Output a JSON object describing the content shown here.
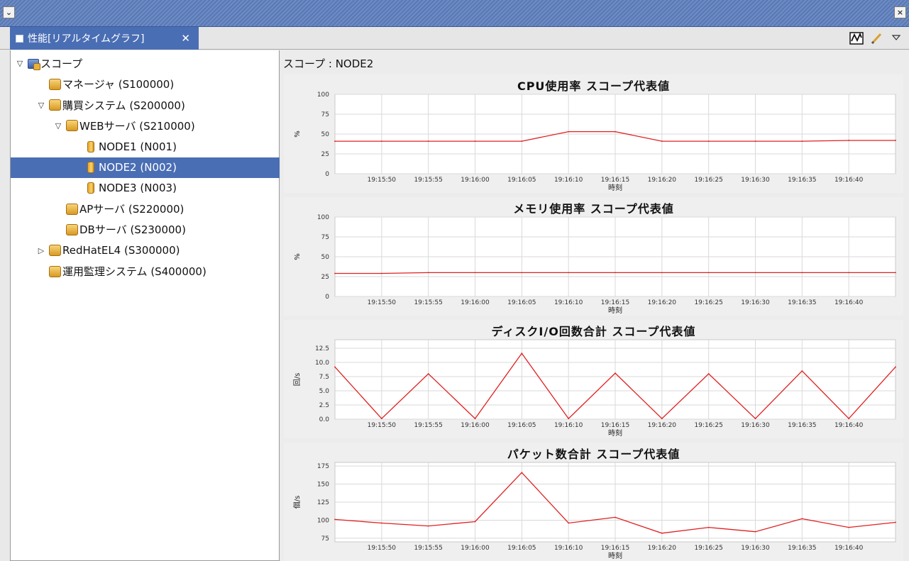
{
  "window": {
    "menu_icon": "chevron-down-icon",
    "close_icon": "close-icon"
  },
  "tab": {
    "label": "性能[リアルタイムグラフ]",
    "close_icon": "close-icon"
  },
  "toolbar": {
    "items": [
      "graph-icon",
      "pencil-icon",
      "view-menu-icon"
    ]
  },
  "tree": {
    "items": [
      {
        "label": "スコープ",
        "level": 0,
        "icon": "scope-icon",
        "twisty": "expanded"
      },
      {
        "label": "マネージャ (S100000)",
        "level": 1,
        "icon": "folder-icon",
        "twisty": "none"
      },
      {
        "label": "購買システム (S200000)",
        "level": 1,
        "icon": "folder-icon",
        "twisty": "expanded"
      },
      {
        "label": "WEBサーバ (S210000)",
        "level": 2,
        "icon": "folder-icon",
        "twisty": "expanded"
      },
      {
        "label": "NODE1 (N001)",
        "level": 3,
        "icon": "node-icon",
        "twisty": "none"
      },
      {
        "label": "NODE2 (N002)",
        "level": 3,
        "icon": "node-icon",
        "twisty": "none",
        "selected": true
      },
      {
        "label": "NODE3 (N003)",
        "level": 3,
        "icon": "node-icon",
        "twisty": "none"
      },
      {
        "label": "APサーバ (S220000)",
        "level": 2,
        "icon": "folder-icon",
        "twisty": "none"
      },
      {
        "label": "DBサーバ (S230000)",
        "level": 2,
        "icon": "folder-icon",
        "twisty": "none"
      },
      {
        "label": "RedHatEL4 (S300000)",
        "level": 1,
        "icon": "folder-icon",
        "twisty": "collapsed"
      },
      {
        "label": "運用監理システム (S400000)",
        "level": 1,
        "icon": "folder-icon",
        "twisty": "none"
      }
    ]
  },
  "scope_label": "スコープ : NODE2",
  "colors": {
    "series": "#e02020",
    "grid": "#d9d9d9",
    "selection": "#4a6eb4"
  },
  "chart_data": [
    {
      "type": "line",
      "title": "CPU使用率 スコープ代表値",
      "xlabel": "時刻",
      "ylabel": "%",
      "x": [
        "19:15:45",
        "19:15:50",
        "19:15:55",
        "19:16:00",
        "19:16:05",
        "19:16:10",
        "19:16:15",
        "19:16:20",
        "19:16:25",
        "19:16:30",
        "19:16:35",
        "19:16:40",
        "19:16:45"
      ],
      "xtick_labels": [
        "19:15:50",
        "19:15:55",
        "19:16:00",
        "19:16:05",
        "19:16:10",
        "19:16:15",
        "19:16:20",
        "19:16:25",
        "19:16:30",
        "19:16:35",
        "19:16:40"
      ],
      "yticks": [
        "0",
        "25",
        "50",
        "75",
        "100"
      ],
      "ylim": [
        0,
        100
      ],
      "values": [
        41,
        41,
        41,
        41,
        41,
        53,
        53,
        41,
        41,
        41,
        41,
        42,
        42
      ],
      "grid": true
    },
    {
      "type": "line",
      "title": "メモリ使用率 スコープ代表値",
      "xlabel": "時刻",
      "ylabel": "%",
      "x": [
        "19:15:45",
        "19:15:50",
        "19:15:55",
        "19:16:00",
        "19:16:05",
        "19:16:10",
        "19:16:15",
        "19:16:20",
        "19:16:25",
        "19:16:30",
        "19:16:35",
        "19:16:40",
        "19:16:45"
      ],
      "xtick_labels": [
        "19:15:50",
        "19:15:55",
        "19:16:00",
        "19:16:05",
        "19:16:10",
        "19:16:15",
        "19:16:20",
        "19:16:25",
        "19:16:30",
        "19:16:35",
        "19:16:40"
      ],
      "yticks": [
        "0",
        "25",
        "50",
        "75",
        "100"
      ],
      "ylim": [
        0,
        100
      ],
      "values": [
        29,
        29,
        30,
        30,
        30,
        30,
        30,
        30,
        30,
        30,
        30,
        30,
        30
      ],
      "grid": true
    },
    {
      "type": "line",
      "title": "ディスクI/O回数合計 スコープ代表値",
      "xlabel": "時刻",
      "ylabel": "回/s",
      "x": [
        "19:15:45",
        "19:15:50",
        "19:15:55",
        "19:16:00",
        "19:16:05",
        "19:16:10",
        "19:16:15",
        "19:16:20",
        "19:16:25",
        "19:16:30",
        "19:16:35",
        "19:16:40",
        "19:16:45"
      ],
      "xtick_labels": [
        "19:15:50",
        "19:15:55",
        "19:16:00",
        "19:16:05",
        "19:16:10",
        "19:16:15",
        "19:16:20",
        "19:16:25",
        "19:16:30",
        "19:16:35",
        "19:16:40"
      ],
      "yticks": [
        "0.0",
        "2.5",
        "5.0",
        "7.5",
        "10.0",
        "12.5"
      ],
      "ylim": [
        0,
        14
      ],
      "values": [
        9.2,
        0.1,
        8.0,
        0.1,
        11.6,
        0.1,
        8.1,
        0.1,
        8.0,
        0.1,
        8.5,
        0.1,
        9.2
      ],
      "grid": true
    },
    {
      "type": "line",
      "title": "パケット数合計 スコープ代表値",
      "xlabel": "時刻",
      "ylabel": "個/s",
      "x": [
        "19:15:45",
        "19:15:50",
        "19:15:55",
        "19:16:00",
        "19:16:05",
        "19:16:10",
        "19:16:15",
        "19:16:20",
        "19:16:25",
        "19:16:30",
        "19:16:35",
        "19:16:40",
        "19:16:45"
      ],
      "xtick_labels": [
        "19:15:50",
        "19:15:55",
        "19:16:00",
        "19:16:05",
        "19:16:10",
        "19:16:15",
        "19:16:20",
        "19:16:25",
        "19:16:30",
        "19:16:35",
        "19:16:40"
      ],
      "yticks": [
        "75",
        "100",
        "125",
        "150",
        "175"
      ],
      "ylim": [
        70,
        180
      ],
      "values": [
        101,
        96,
        92,
        98,
        166,
        96,
        104,
        82,
        90,
        84,
        102,
        90,
        97
      ],
      "grid": true
    }
  ]
}
